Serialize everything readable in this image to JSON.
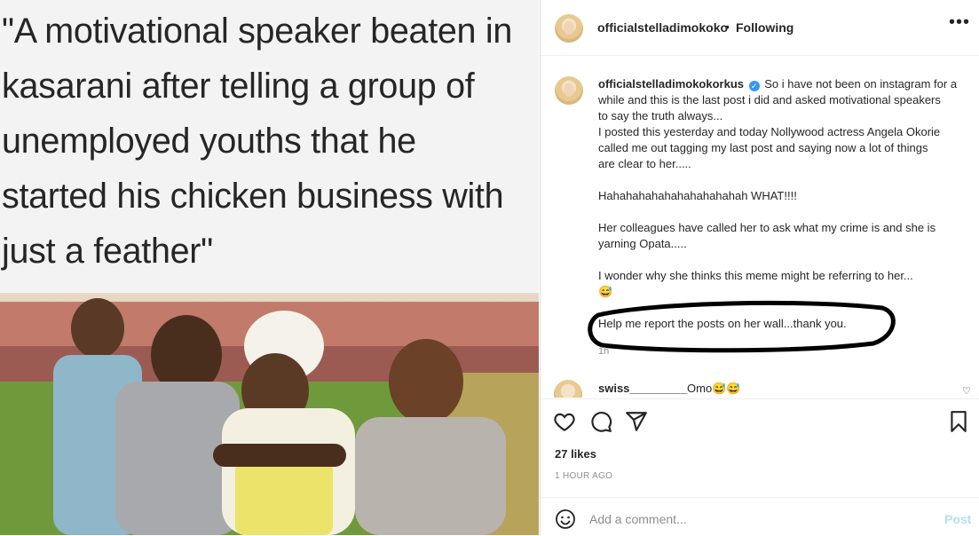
{
  "media": {
    "meme_lines": [
      "\"A motivational speaker beaten in",
      "kasarani after telling a group of",
      "unemployed youths that he",
      "started his chicken business with",
      "just a feather\""
    ]
  },
  "header": {
    "username": "officialstelladimokoko",
    "separator": "•",
    "follow_status": "Following",
    "more_label": "•••"
  },
  "caption": {
    "username": "officialstelladimokokorkus",
    "verified_glyph": "✓",
    "lines": [
      "So i have not been on instagram for a",
      "while and this is the last post i did and asked motivational speakers",
      "to say the truth always...",
      "I posted this yesterday and today Nollywood actress Angela Okorie",
      "called me out tagging my last post and saying now a lot of things",
      "are clear to her.....",
      "",
      "Hahahahahahahahahahahah WHAT!!!!",
      "",
      "Her colleagues have called her to ask what my crime is and she is",
      "yarning Opata.....",
      "",
      "I wonder why she thinks this meme might be referring to her...",
      "😅",
      "",
      "Help me report the posts on her wall...thank you."
    ],
    "time": "1h"
  },
  "comment": {
    "username": "swiss_________",
    "text": "Omo😅😅",
    "heart": "♡"
  },
  "engagement": {
    "likes": "27 likes",
    "time_ago": "1 HOUR AGO"
  },
  "add_comment": {
    "placeholder": "Add a comment...",
    "post_label": "Post"
  },
  "colors": {
    "link_blue": "#3897f0",
    "post_disabled": "#b2dffc",
    "muted": "#8e8e8e"
  }
}
